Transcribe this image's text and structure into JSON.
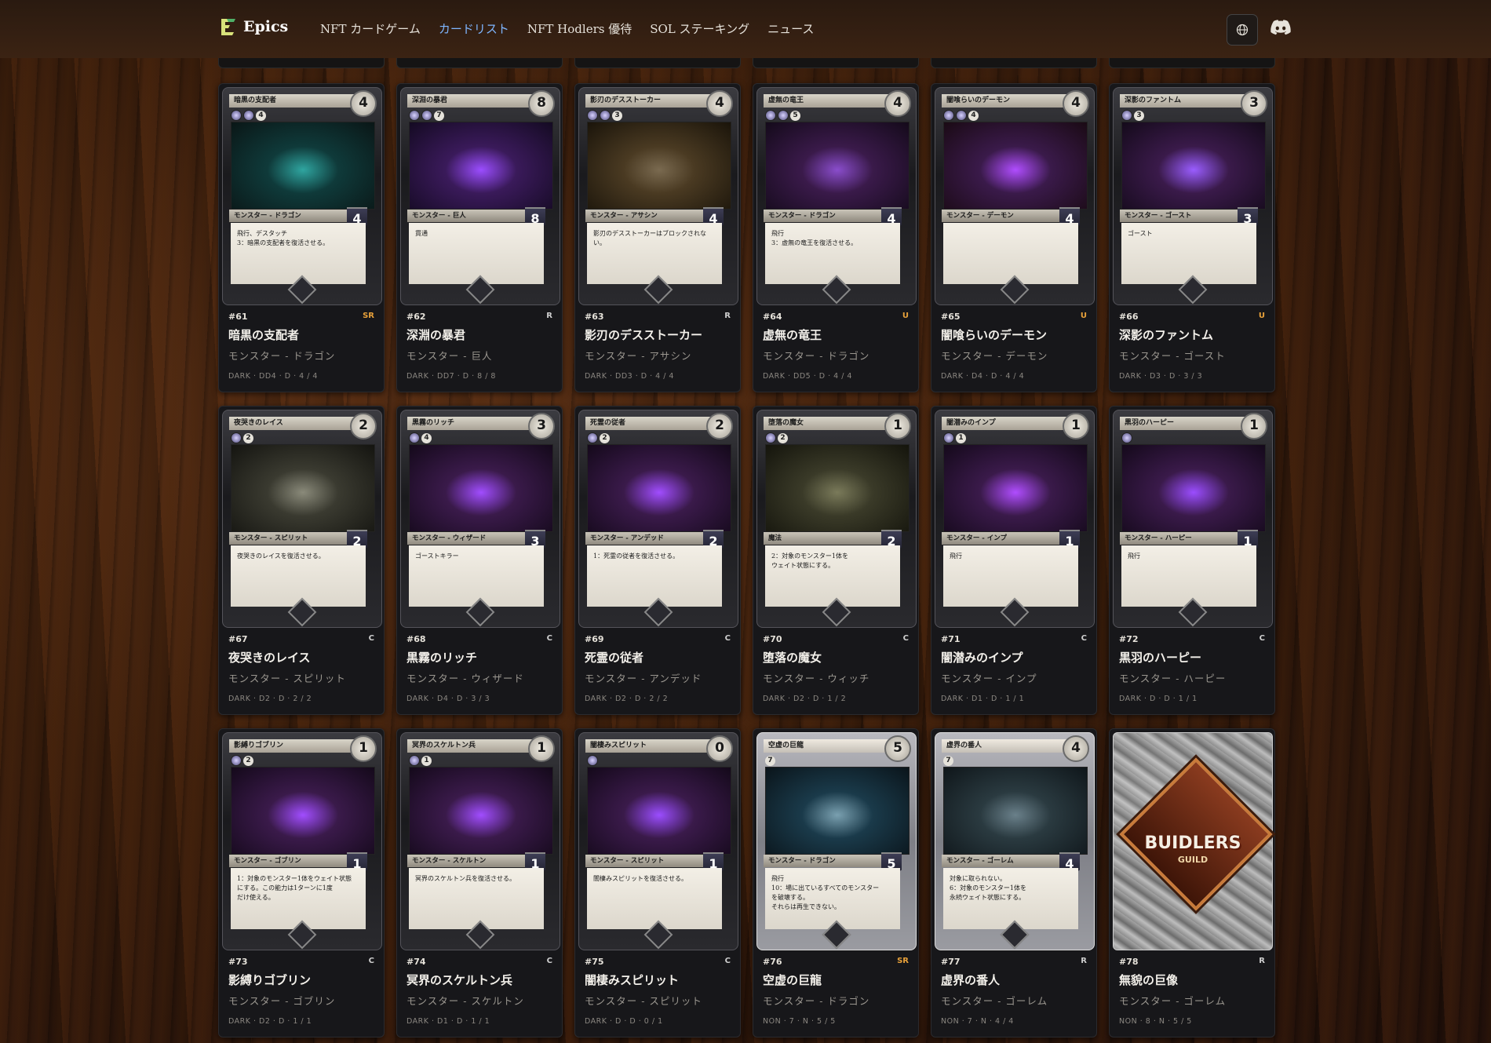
{
  "header": {
    "logo_text": "Epics",
    "nav": [
      {
        "label": "NFT カードゲーム",
        "active": false
      },
      {
        "label": "カードリスト",
        "active": true
      },
      {
        "label": "NFT Hodlers 優待",
        "active": false
      },
      {
        "label": "SOL ステーキング",
        "active": false
      },
      {
        "label": "ニュース",
        "active": false
      }
    ],
    "language_icon": "globe-icon",
    "discord_icon": "discord-icon"
  },
  "colors": {
    "accent": "#7fb6ff",
    "rarity_SR": "#e8a13a",
    "rarity_U": "#e8a13a",
    "rarity_R": "#cfcfcf",
    "rarity_C": "#cfcfcf"
  },
  "cards": [
    {
      "number": "#61",
      "rarity": "SR",
      "name": "暗黒の支配者",
      "subtype": "モンスター - ドラゴン",
      "stats": "DARK · DD4 · D · 4 / 4",
      "card_title": "暗黒の支配者",
      "cost": "4",
      "mana": "4",
      "type_line": "モンスター - ドラゴン",
      "power": "4",
      "text": "飛行、デスタッチ\n3：暗黒の支配者を復活させる。",
      "style": "dark",
      "art": [
        "#0f3a3a",
        "#0a1616",
        "#2fa5a0"
      ]
    },
    {
      "number": "#62",
      "rarity": "R",
      "name": "深淵の暴君",
      "subtype": "モンスター - 巨人",
      "stats": "DARK · DD7 · D · 8 / 8",
      "card_title": "深淵の暴君",
      "cost": "8",
      "mana": "7",
      "type_line": "モンスター - 巨人",
      "power": "8",
      "text": "貫通",
      "style": "dark",
      "art": [
        "#3a1a5a",
        "#140a22",
        "#9b4dff"
      ]
    },
    {
      "number": "#63",
      "rarity": "R",
      "name": "影刃のデスストーカー",
      "subtype": "モンスター - アサシン",
      "stats": "DARK · DD3 · D · 4 / 4",
      "card_title": "影刃のデスストーカー",
      "cost": "4",
      "mana": "3",
      "type_line": "モンスター - アサシン",
      "power": "4",
      "text": "影刃のデスストーカーはブロックされない。",
      "style": "dark",
      "art": [
        "#4a3a22",
        "#1a140a",
        "#7a6a50"
      ]
    },
    {
      "number": "#64",
      "rarity": "U",
      "name": "虚無の竜王",
      "subtype": "モンスター - ドラゴン",
      "stats": "DARK · DD5 · D · 4 / 4",
      "card_title": "虚無の竜王",
      "cost": "4",
      "mana": "5",
      "type_line": "モンスター - ドラゴン",
      "power": "4",
      "text": "飛行\n3：虚無の竜王を復活させる。",
      "style": "dark",
      "art": [
        "#3a1a4a",
        "#140a1a",
        "#8a4dcc"
      ]
    },
    {
      "number": "#65",
      "rarity": "U",
      "name": "闇喰らいのデーモン",
      "subtype": "モンスター - デーモン",
      "stats": "DARK · D4 · D · 4 / 4",
      "card_title": "闇喰らいのデーモン",
      "cost": "4",
      "mana": "4",
      "type_line": "モンスター - デーモン",
      "power": "4",
      "text": "",
      "style": "dark",
      "art": [
        "#3a1a4a",
        "#1a0a14",
        "#b04dff"
      ]
    },
    {
      "number": "#66",
      "rarity": "U",
      "name": "深影のファントム",
      "subtype": "モンスター - ゴースト",
      "stats": "DARK · D3 · D · 3 / 3",
      "card_title": "深影のファントム",
      "cost": "3",
      "mana": "3",
      "type_line": "モンスター - ゴースト",
      "power": "3",
      "text": "ゴースト",
      "style": "dark",
      "art": [
        "#3a1a4a",
        "#140a1a",
        "#9a5dff"
      ]
    },
    {
      "number": "#67",
      "rarity": "C",
      "name": "夜哭きのレイス",
      "subtype": "モンスター - スピリット",
      "stats": "DARK · D2 · D · 2 / 2",
      "card_title": "夜哭きのレイス",
      "cost": "2",
      "mana": "2",
      "type_line": "モンスター - スピリット",
      "power": "2",
      "text": "夜哭きのレイスを復活させる。",
      "style": "dark",
      "art": [
        "#3a3a30",
        "#141410",
        "#8a8a7a"
      ]
    },
    {
      "number": "#68",
      "rarity": "C",
      "name": "黒霧のリッチ",
      "subtype": "モンスター - ウィザード",
      "stats": "DARK · D4 · D · 3 / 3",
      "card_title": "黒霧のリッチ",
      "cost": "3",
      "mana": "4",
      "type_line": "モンスター - ウィザード",
      "power": "3",
      "text": "ゴーストキラー",
      "style": "dark",
      "art": [
        "#3a1a4a",
        "#14091a",
        "#a14dff"
      ]
    },
    {
      "number": "#69",
      "rarity": "C",
      "name": "死霊の従者",
      "subtype": "モンスター - アンデッド",
      "stats": "DARK · D2 · D · 2 / 2",
      "card_title": "死霊の従者",
      "cost": "2",
      "mana": "2",
      "type_line": "モンスター - アンデッド",
      "power": "2",
      "text": "1：死霊の従者を復活させる。",
      "style": "dark",
      "art": [
        "#3a1a4a",
        "#14091a",
        "#a14dff"
      ]
    },
    {
      "number": "#70",
      "rarity": "C",
      "name": "堕落の魔女",
      "subtype": "モンスター - ウィッチ",
      "stats": "DARK · D2 · D · 1 / 2",
      "card_title": "堕落の魔女",
      "cost": "1",
      "mana": "2",
      "type_line": "魔法",
      "power": "2",
      "text": "2：対象のモンスター1体を\nウェイト状態にする。",
      "style": "dark",
      "art": [
        "#3a3a28",
        "#14140c",
        "#7a7a5a"
      ]
    },
    {
      "number": "#71",
      "rarity": "C",
      "name": "闇潜みのインプ",
      "subtype": "モンスター - インプ",
      "stats": "DARK · D1 · D · 1 / 1",
      "card_title": "闇潜みのインプ",
      "cost": "1",
      "mana": "1",
      "type_line": "モンスター - インプ",
      "power": "1",
      "text": "飛行",
      "style": "dark",
      "art": [
        "#3a1a4a",
        "#14091a",
        "#b04dff"
      ]
    },
    {
      "number": "#72",
      "rarity": "C",
      "name": "黒羽のハーピー",
      "subtype": "モンスター - ハーピー",
      "stats": "DARK · D · D · 1 / 1",
      "card_title": "黒羽のハーピー",
      "cost": "1",
      "mana": "",
      "type_line": "モンスター - ハーピー",
      "power": "1",
      "text": "飛行",
      "style": "dark",
      "art": [
        "#3a1a4a",
        "#14091a",
        "#9b4dff"
      ]
    },
    {
      "number": "#73",
      "rarity": "C",
      "name": "影縛りゴブリン",
      "subtype": "モンスター - ゴブリン",
      "stats": "DARK · D2 · D · 1 / 1",
      "card_title": "影縛りゴブリン",
      "cost": "1",
      "mana": "2",
      "type_line": "モンスター - ゴブリン",
      "power": "1",
      "text": "1：対象のモンスター1体をウェイト状態\nにする。この能力は1ターンに1度\nだけ使える。",
      "style": "dark",
      "art": [
        "#3a1a4a",
        "#14091a",
        "#a14dff"
      ]
    },
    {
      "number": "#74",
      "rarity": "C",
      "name": "冥界のスケルトン兵",
      "subtype": "モンスター - スケルトン",
      "stats": "DARK · D1 · D · 1 / 1",
      "card_title": "冥界のスケルトン兵",
      "cost": "1",
      "mana": "1",
      "type_line": "モンスター - スケルトン",
      "power": "1",
      "text": "冥界のスケルトン兵を復活させる。",
      "style": "dark",
      "art": [
        "#3a1a4a",
        "#14091a",
        "#a14dff"
      ]
    },
    {
      "number": "#75",
      "rarity": "C",
      "name": "闇棲みスピリット",
      "subtype": "モンスター - スピリット",
      "stats": "DARK · D · D · 0 / 1",
      "card_title": "闇棲みスピリット",
      "cost": "0",
      "mana": "",
      "type_line": "モンスター - スピリット",
      "power": "1",
      "text": "闇棲みスピリットを復活させる。",
      "style": "dark",
      "art": [
        "#3a1a4a",
        "#14091a",
        "#9b4dff"
      ]
    },
    {
      "number": "#76",
      "rarity": "SR",
      "name": "空虚の巨龍",
      "subtype": "モンスター - ドラゴン",
      "stats": "NON · 7 · N · 5 / 5",
      "card_title": "空虚の巨龍",
      "cost": "5",
      "mana": "7",
      "type_line": "モンスター - ドラゴン",
      "power": "5",
      "text": "飛行\n10：場に出ているすべてのモンスター\nを破壊する。\nそれらは再生できない。",
      "style": "colorless",
      "art": [
        "#1a3a4a",
        "#0a141a",
        "#7aa0b0"
      ]
    },
    {
      "number": "#77",
      "rarity": "R",
      "name": "虚界の番人",
      "subtype": "モンスター - ゴーレム",
      "stats": "NON · 7 · N · 4 / 4",
      "card_title": "虚界の番人",
      "cost": "4",
      "mana": "7",
      "type_line": "モンスター - ゴーレム",
      "power": "4",
      "text": "対象に取られない。\n6：対象のモンスター1体を\n永続ウェイト状態にする。",
      "style": "colorless",
      "art": [
        "#2a3a40",
        "#0f161a",
        "#6a808a"
      ]
    },
    {
      "number": "#78",
      "rarity": "R",
      "name": "無貌の巨像",
      "subtype": "モンスター - ゴーレム",
      "stats": "NON · 8 · N · 5 / 5",
      "style": "back",
      "back_title": "BUIDLERS",
      "back_sub": "GUILD"
    }
  ]
}
